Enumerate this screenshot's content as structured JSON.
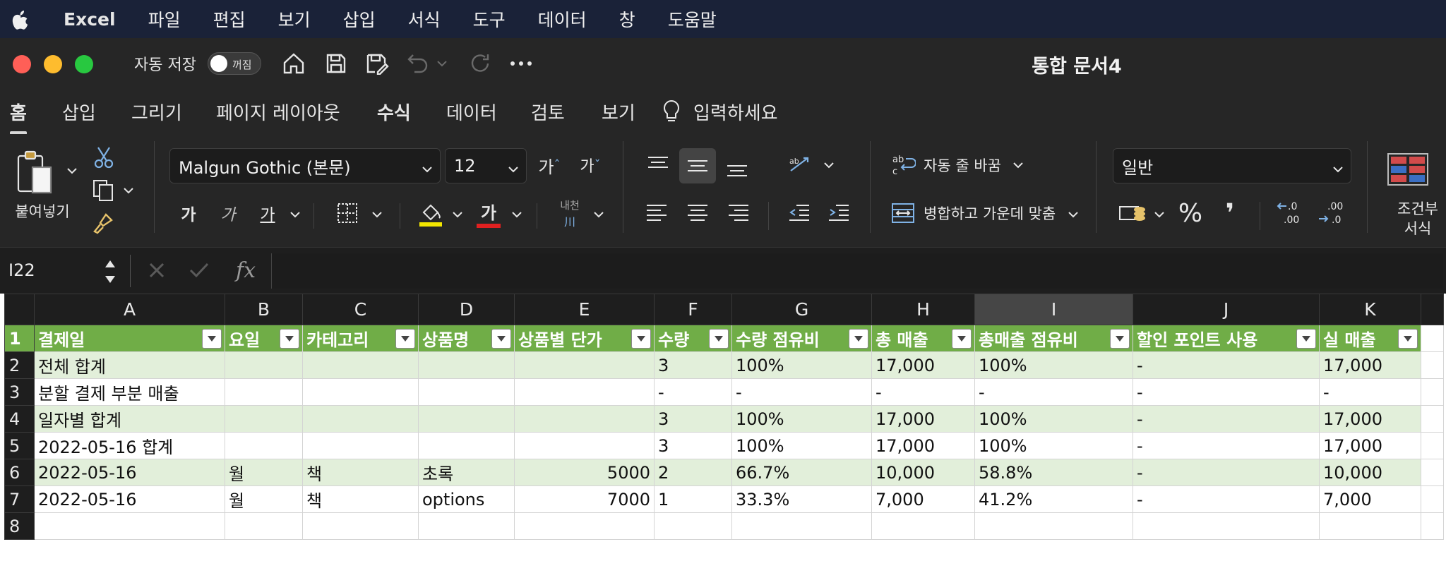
{
  "menubar": {
    "app_name": "Excel",
    "items": [
      "파일",
      "편집",
      "보기",
      "삽입",
      "서식",
      "도구",
      "데이터",
      "창",
      "도움말"
    ]
  },
  "titlebar": {
    "autosave_label": "자동 저장",
    "autosave_state": "꺼짐",
    "document_title": "통합 문서4"
  },
  "ribbon_tabs": [
    "홈",
    "삽입",
    "그리기",
    "페이지 레이아웃",
    "수식",
    "데이터",
    "검토",
    "보기"
  ],
  "ribbon_tabs_active": "홈",
  "tell_me": "입력하세요",
  "ribbon": {
    "paste_label": "붙여넣기",
    "font_name": "Malgun Gothic (본문)",
    "font_size": "12",
    "grow_font": "가",
    "shrink_font": "가",
    "bold": "가",
    "italic": "가",
    "underline": "가",
    "font_color_glyph": "가",
    "phonetic_label": "내천",
    "wrap_text": "자동 줄 바꿈",
    "merge_center": "병합하고 가운데 맞춤",
    "number_format": "일반",
    "conditional_format_line1": "조건부",
    "conditional_format_line2": "서식",
    "accent_underline_yellow": "#f2e600",
    "accent_underline_red": "#e02020"
  },
  "formula_bar": {
    "name_box": "I22",
    "fx": "fx",
    "content": ""
  },
  "sheet": {
    "columns": [
      "A",
      "B",
      "C",
      "D",
      "E",
      "F",
      "G",
      "H",
      "I",
      "J",
      "K"
    ],
    "selected_column": "I",
    "header_fill": "#70ad47",
    "band_fill": "#e2efda",
    "header_row": [
      "결제일",
      "요일",
      "카테고리",
      "상품명",
      "상품별 단가",
      "수량",
      "수량 점유비",
      "총 매출",
      "총매출 점유비",
      "할인 포인트 사용",
      "실 매출"
    ],
    "rows": [
      [
        "전체 합계",
        "",
        "",
        "",
        "",
        "3",
        "100%",
        "17,000",
        "100%",
        "-",
        "17,000"
      ],
      [
        "분할 결제 부분 매출",
        "",
        "",
        "",
        "",
        "-",
        "-",
        "-",
        "-",
        "-",
        "-"
      ],
      [
        "일자별 합계",
        "",
        "",
        "",
        "",
        "3",
        "100%",
        "17,000",
        "100%",
        "-",
        "17,000"
      ],
      [
        "2022-05-16 합계",
        "",
        "",
        "",
        "",
        "3",
        "100%",
        "17,000",
        "100%",
        "-",
        "17,000"
      ],
      [
        "2022-05-16",
        "월",
        "책",
        "초록",
        "5000",
        "2",
        "66.7%",
        "10,000",
        "58.8%",
        "-",
        "10,000"
      ],
      [
        "2022-05-16",
        "월",
        "책",
        "options",
        "7000",
        "1",
        "33.3%",
        "7,000",
        "41.2%",
        "-",
        "7,000"
      ],
      [
        "",
        "",
        "",
        "",
        "",
        "",
        "",
        "",
        "",
        "",
        ""
      ]
    ],
    "row_numbers": [
      "1",
      "2",
      "3",
      "4",
      "5",
      "6",
      "7",
      "8"
    ]
  }
}
